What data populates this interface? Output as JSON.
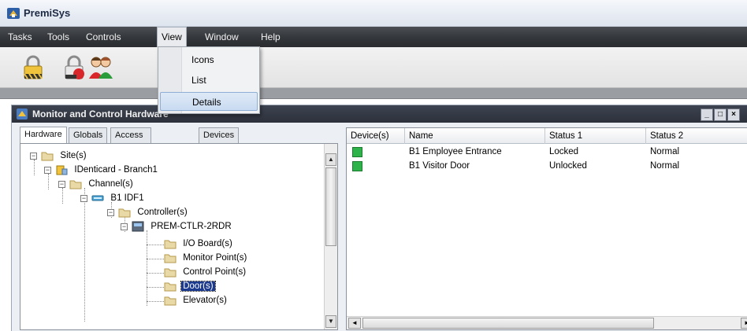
{
  "app": {
    "title": "PremiSys",
    "icon": "premisys-app-icon"
  },
  "menubar": {
    "items": [
      {
        "label": "Tasks"
      },
      {
        "label": "Tools"
      },
      {
        "label": "Controls"
      },
      {
        "label": "View"
      },
      {
        "label": "Window"
      },
      {
        "label": "Help"
      }
    ],
    "open_menu": "View"
  },
  "view_menu": {
    "items": [
      {
        "label": "Icons"
      },
      {
        "label": "List"
      },
      {
        "label": "Details",
        "highlighted": true
      }
    ]
  },
  "toolbar": {
    "buttons": [
      {
        "icon": "padlock-icon"
      },
      {
        "icon": "padlock-alarm-icon"
      },
      {
        "icon": "users-group-icon"
      }
    ]
  },
  "child_window": {
    "title": "Monitor and Control Hardware",
    "icon": "monitor-hardware-icon",
    "controls": [
      "_",
      "□",
      "×"
    ]
  },
  "tabs": [
    {
      "label": "Hardware",
      "active": true
    },
    {
      "label": "Globals"
    },
    {
      "label": "Access Settings"
    },
    {
      "label": "Devices"
    }
  ],
  "tree": {
    "nodes": [
      {
        "label": "Site(s)",
        "icon": "folder-icon"
      },
      {
        "label": "IDenticard - Branch1",
        "icon": "building-icon"
      },
      {
        "label": "Channel(s)",
        "icon": "folder-icon"
      },
      {
        "label": "B1 IDF1",
        "icon": "channel-icon"
      },
      {
        "label": "Controller(s)",
        "icon": "folder-icon"
      },
      {
        "label": "PREM-CTLR-2RDR",
        "icon": "controller-icon"
      },
      {
        "label": "I/O Board(s)",
        "icon": "folder-icon"
      },
      {
        "label": "Monitor Point(s)",
        "icon": "folder-icon"
      },
      {
        "label": "Control Point(s)",
        "icon": "folder-icon"
      },
      {
        "label": "Door(s)",
        "icon": "folder-icon",
        "selected": true
      },
      {
        "label": "Elevator(s)",
        "icon": "folder-icon"
      }
    ]
  },
  "list": {
    "columns": [
      "Device(s)",
      "Name",
      "Status 1",
      "Status 2"
    ],
    "rows": [
      {
        "device_status_color": "#2db34a",
        "name": "B1 Employee Entrance",
        "status1": "Locked",
        "status2": "Normal"
      },
      {
        "device_status_color": "#2db34a",
        "name": "B1 Visitor Door",
        "status1": "Unlocked",
        "status2": "Normal"
      }
    ]
  },
  "colors": {
    "menubar_bg": "#33363a",
    "selection": "#1c3b8e",
    "device_ok": "#2db34a"
  }
}
